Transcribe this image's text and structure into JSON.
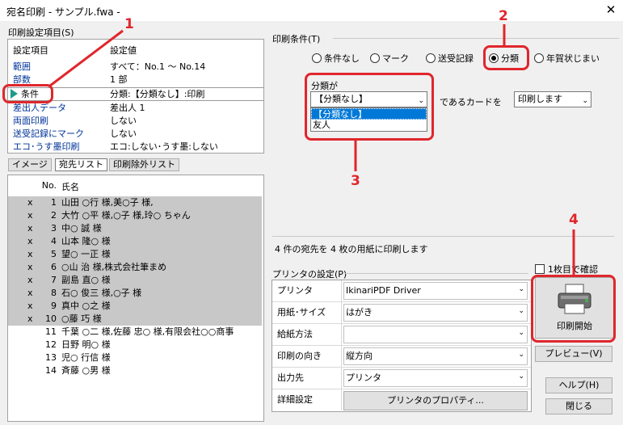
{
  "window": {
    "title": "宛名印刷 - サンプル.fwa -",
    "close": "✕"
  },
  "settings": {
    "group_label": "印刷設定項目(S)",
    "col1": "設定項目",
    "col2": "設定値",
    "rows": [
      {
        "name": "範囲",
        "value": "すべて：No.1 ～ No.14"
      },
      {
        "name": "部数",
        "value": "1 部"
      },
      {
        "name": "条件",
        "value": "分類:【分類なし】:印刷"
      },
      {
        "name": "差出人データ",
        "value": "差出人 1"
      },
      {
        "name": "両面印刷",
        "value": "しない"
      },
      {
        "name": "送受記録にマーク",
        "value": "しない"
      },
      {
        "name": "エコ･うす墨印刷",
        "value": "エコ:しない･うす墨:しない"
      }
    ]
  },
  "tabs": [
    "イメージ",
    "宛先リスト",
    "印刷除外リスト"
  ],
  "list": {
    "col_no": "No.",
    "col_name": "氏名",
    "rows": [
      {
        "x": "x",
        "no": "1",
        "name": "山田 ○行 様,美○子 様,"
      },
      {
        "x": "x",
        "no": "2",
        "name": "大竹 ○平 様,○子 様,玲○ ちゃん"
      },
      {
        "x": "x",
        "no": "3",
        "name": "中○ 誠 様"
      },
      {
        "x": "x",
        "no": "4",
        "name": "山本 隆○ 様"
      },
      {
        "x": "x",
        "no": "5",
        "name": "望○ 一正 様"
      },
      {
        "x": "x",
        "no": "6",
        "name": "○山 治 様,株式会社筆まめ"
      },
      {
        "x": "x",
        "no": "7",
        "name": "副島 直○ 様"
      },
      {
        "x": "x",
        "no": "8",
        "name": "石○ 俊三 様,○子 様"
      },
      {
        "x": "x",
        "no": "9",
        "name": "真中 ○之 様"
      },
      {
        "x": "x",
        "no": "10",
        "name": "○藤 巧 様"
      },
      {
        "x": "",
        "no": "11",
        "name": "千葉 ○二 様,佐藤 忠○ 様,有限会社○○商事"
      },
      {
        "x": "",
        "no": "12",
        "name": "日野 明○ 様"
      },
      {
        "x": "",
        "no": "13",
        "name": "児○ 行信 様"
      },
      {
        "x": "",
        "no": "14",
        "name": "斉藤 ○男 様"
      }
    ]
  },
  "conditions": {
    "group_label": "印刷条件(T)",
    "radios": [
      "条件なし",
      "マーク",
      "送受記録",
      "分類",
      "年賀状じまい"
    ],
    "selected": "分類",
    "class_label": "分類が",
    "class_value": "【分類なし】",
    "dropdown_options": [
      "【分類なし】",
      "友人"
    ],
    "card_label": "であるカードを",
    "action_value": "印刷します"
  },
  "summary": "4 件の宛先を 4 枚の用紙に印刷します",
  "printer": {
    "group_label": "プリンタの設定(P)",
    "rows": [
      {
        "label": "プリンタ",
        "value": "IkinariPDF Driver"
      },
      {
        "label": "用紙･サイズ",
        "value": "はがき"
      },
      {
        "label": "給紙方法",
        "value": ""
      },
      {
        "label": "印刷の向き",
        "value": "縦方向"
      },
      {
        "label": "出力先",
        "value": "プリンタ"
      }
    ],
    "detail_label": "詳細設定",
    "properties_button": "プリンタのプロパティ..."
  },
  "buttons": {
    "check_first": "1枚目で確認",
    "print": "印刷開始",
    "preview": "プレビュー(V)",
    "help": "ヘルプ(H)",
    "close": "閉じる"
  },
  "annotations": [
    "1",
    "2",
    "3",
    "4"
  ],
  "colors": {
    "annotation": "#e0262c",
    "selected_row": "#c8c8c8",
    "highlight": "#0078d7"
  }
}
